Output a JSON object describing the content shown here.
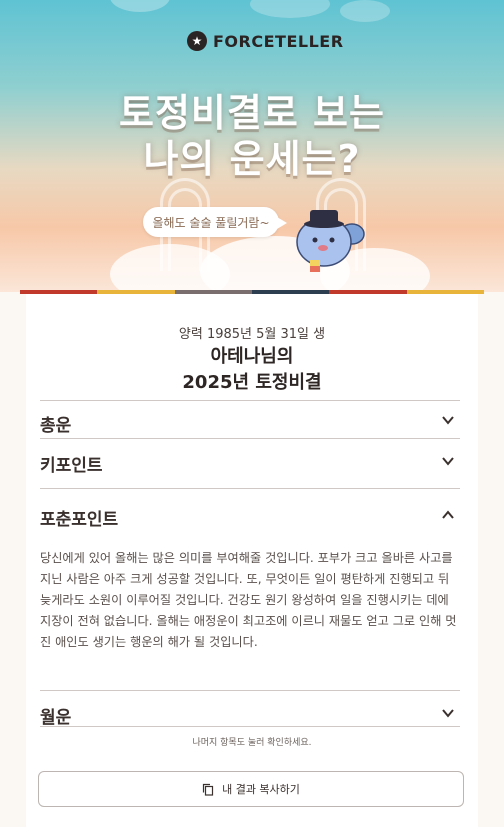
{
  "brand": {
    "logo_text": "FORCETELLER",
    "logo_icon": "star-badge-icon"
  },
  "hero": {
    "title_line1": "토정비결로 보는",
    "title_line2": "나의 운세는?",
    "bubble_text": "올해도 술술 풀릴거람~",
    "mascot": "koala-mascot"
  },
  "stripe_colors": [
    "#c0392b",
    "#e8b53a",
    "#7a6e6e",
    "#2c3e50",
    "#c0392b",
    "#e8b53a"
  ],
  "result": {
    "birth_line": "양력 1985년 5월 31일 생",
    "name_line": "아테나님의",
    "year_line": "2025년 토정비결"
  },
  "sections": [
    {
      "label": "총운",
      "expanded": false
    },
    {
      "label": "키포인트",
      "expanded": false
    },
    {
      "label": "포춘포인트",
      "expanded": true,
      "content": "당신에게 있어 올해는 많은 의미를 부여해줄 것입니다. 포부가 크고 올바른 사고를 지닌 사람은 아주 크게 성공할 것입니다. 또, 무엇이든 일이 평탄하게 진행되고 뒤늦게라도 소원이 이루어질 것입니다. 건강도 원기 왕성하여 일을 진행시키는 데에 지장이 전혀 없습니다. 올해는 애정운이 최고조에 이르니 재물도 얻고 그로 인해 멋진 애인도 생기는 행운의 해가 될 것입니다."
    },
    {
      "label": "월운",
      "expanded": false
    }
  ],
  "note": "나머지 항목도 눌러 확인하세요.",
  "copy_button": {
    "label": "내 결과 복사하기",
    "icon": "copy-icon"
  }
}
